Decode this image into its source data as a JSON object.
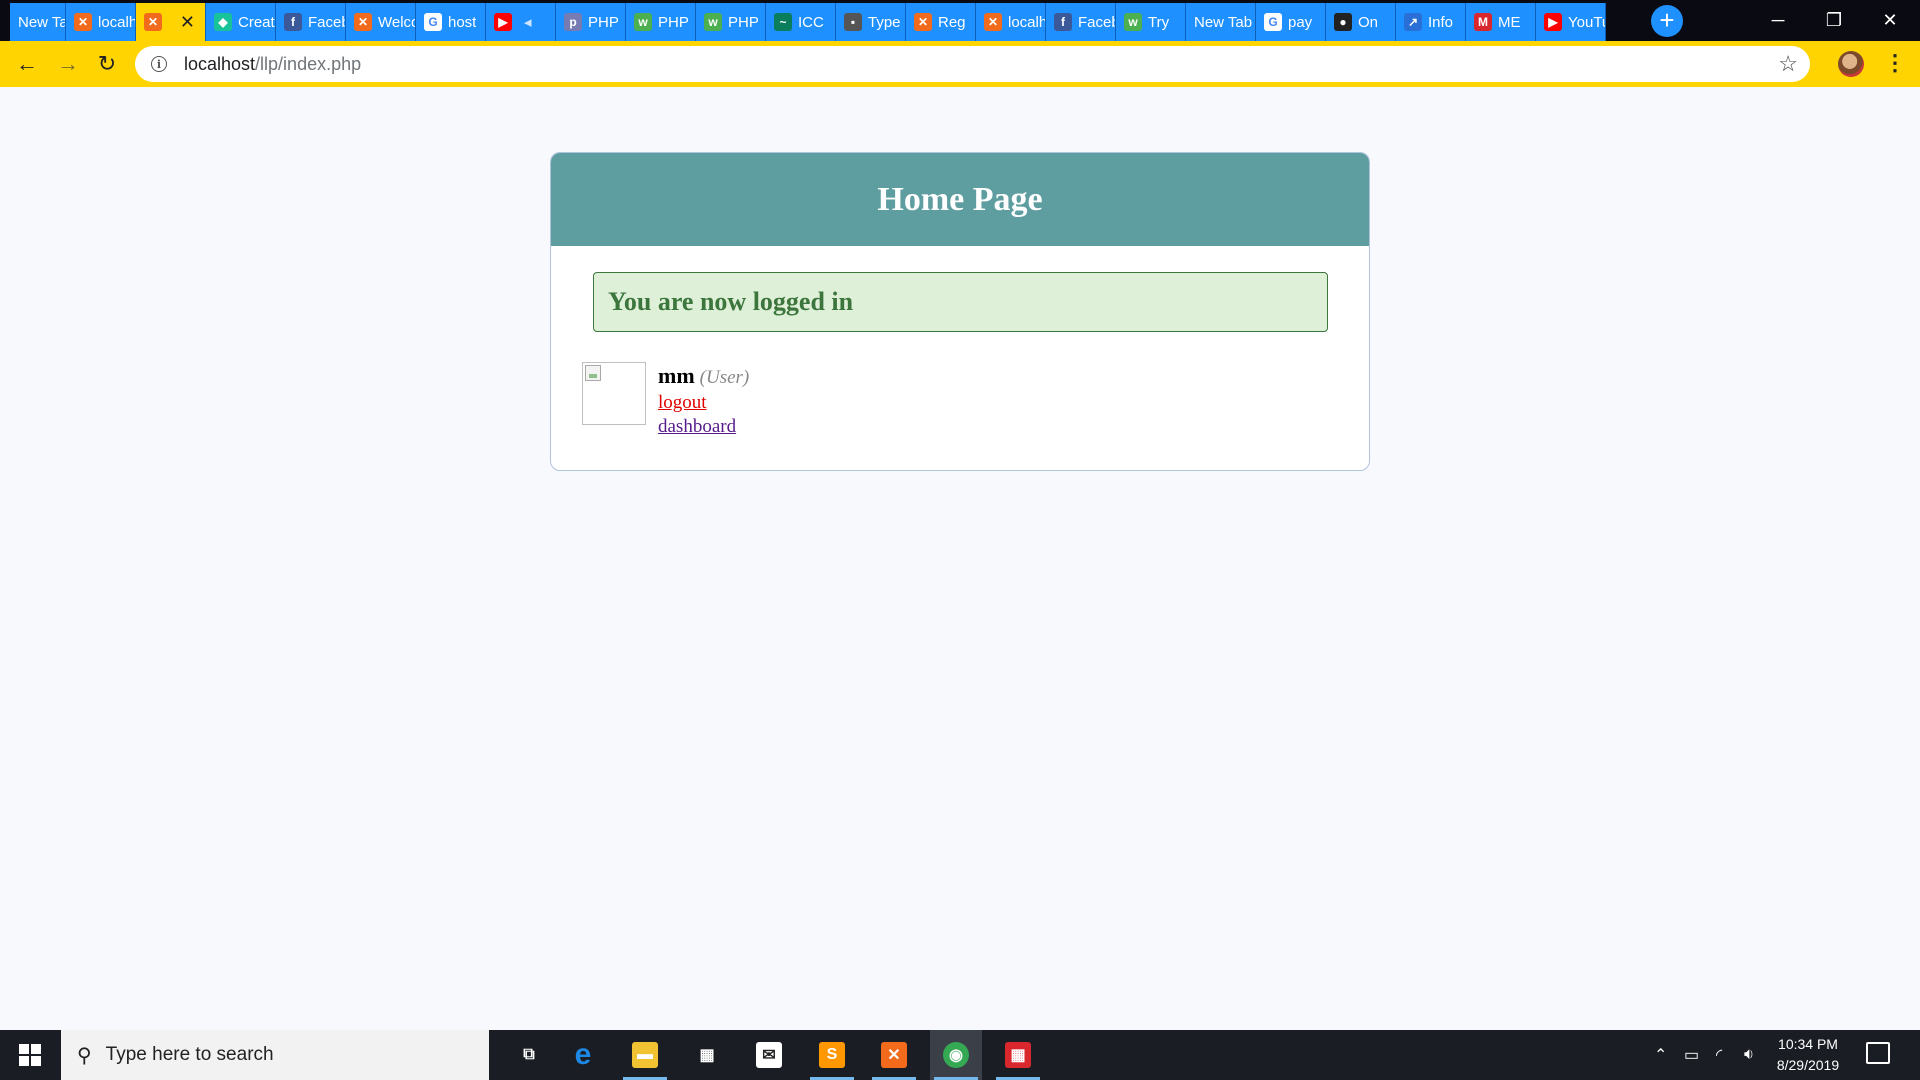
{
  "browser": {
    "tabs": [
      {
        "title": "New Tab",
        "favicon": "none"
      },
      {
        "title": "localhost",
        "favicon": "xampp-icon"
      },
      {
        "title": "",
        "favicon": "xampp-icon",
        "active": true
      },
      {
        "title": "Create",
        "favicon": "tag-icon"
      },
      {
        "title": "Facebook",
        "favicon": "facebook-icon"
      },
      {
        "title": "Welcome",
        "favicon": "xampp-icon"
      },
      {
        "title": "host",
        "favicon": "google-icon"
      },
      {
        "title": "",
        "favicon": "youtube-icon",
        "muted": true
      },
      {
        "title": "PHP",
        "favicon": "php-icon"
      },
      {
        "title": "PHP",
        "favicon": "w3schools-icon"
      },
      {
        "title": "PHP",
        "favicon": "w3schools-icon"
      },
      {
        "title": "ICC",
        "favicon": "icc-icon"
      },
      {
        "title": "Type",
        "favicon": "photo-icon"
      },
      {
        "title": "Reg",
        "favicon": "xampp-icon"
      },
      {
        "title": "localhost",
        "favicon": "xampp-icon"
      },
      {
        "title": "Facebook",
        "favicon": "facebook-icon"
      },
      {
        "title": "Try",
        "favicon": "w3schools-icon"
      },
      {
        "title": "New Tab",
        "favicon": "none"
      },
      {
        "title": "pay",
        "favicon": "google-icon"
      },
      {
        "title": "On",
        "favicon": "globe-icon"
      },
      {
        "title": "Info",
        "favicon": "chart-icon"
      },
      {
        "title": "ME",
        "favicon": "mega-icon"
      },
      {
        "title": "YouTube",
        "favicon": "youtube-icon"
      }
    ],
    "new_tab_label": "+",
    "window_controls": {
      "minimize": "─",
      "restore": "❐",
      "close": "✕"
    },
    "toolbar": {
      "back": "←",
      "forward": "→",
      "reload": "↻",
      "url_host": "localhost",
      "url_path": "/llp/index.php",
      "star": "☆",
      "menu": "⋮"
    }
  },
  "page": {
    "header_title": "Home Page",
    "success_message": "You are now logged in",
    "profile": {
      "username": "mm",
      "role": "(User)",
      "logout_link": "logout",
      "dashboard_link": "dashboard"
    },
    "colors": {
      "header_bg": "#5f9ea0",
      "success_bg": "#dff0d8",
      "success_text": "#3c763d",
      "logout_link": "#e00000",
      "dashboard_link": "#551a8b"
    }
  },
  "taskbar": {
    "search_placeholder": "Type here to search",
    "apps": [
      {
        "name": "task-view-icon"
      },
      {
        "name": "edge-icon"
      },
      {
        "name": "file-explorer-icon"
      },
      {
        "name": "store-icon"
      },
      {
        "name": "mail-icon"
      },
      {
        "name": "sublime-text-icon"
      },
      {
        "name": "xampp-icon"
      },
      {
        "name": "chrome-icon"
      },
      {
        "name": "app-grid-icon"
      }
    ],
    "time": "10:34 PM",
    "date": "8/29/2019"
  }
}
